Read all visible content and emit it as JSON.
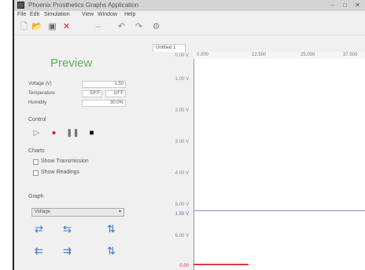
{
  "window": {
    "title": "Phoenix Prosthetics Graphs Application"
  },
  "menu": [
    "File",
    "Edit",
    "Simulation",
    "View",
    "Window",
    "Help"
  ],
  "toolbar": {
    "new": "new-file",
    "open": "open-folder",
    "save": "save",
    "delete": "delete"
  },
  "preview": {
    "label": "Preview"
  },
  "fields": [
    {
      "label": "Voltage (V)",
      "value": "1.50"
    },
    {
      "label": "Temperature",
      "value1": "50°F",
      "value2": "10°F"
    },
    {
      "label": "Humidity",
      "value": "30.0%"
    }
  ],
  "control": {
    "label": "Control"
  },
  "charts": {
    "label": "Charts",
    "show_transmission": "Show Transmission",
    "show_readings": "Show Readings"
  },
  "graph": {
    "label": "Graph",
    "selected": "Voltage"
  },
  "chart": {
    "tab": "Untitled 1",
    "col1": "0.000",
    "col2": "12.500",
    "col3": "25.000",
    "col4": "37.500",
    "yticks": [
      "0.00 V",
      "1.00 V",
      "2.00 V",
      "3.00 V",
      "4.00 V",
      "5.00 V",
      "6.00 V",
      "1.50 V",
      "0.00"
    ]
  }
}
